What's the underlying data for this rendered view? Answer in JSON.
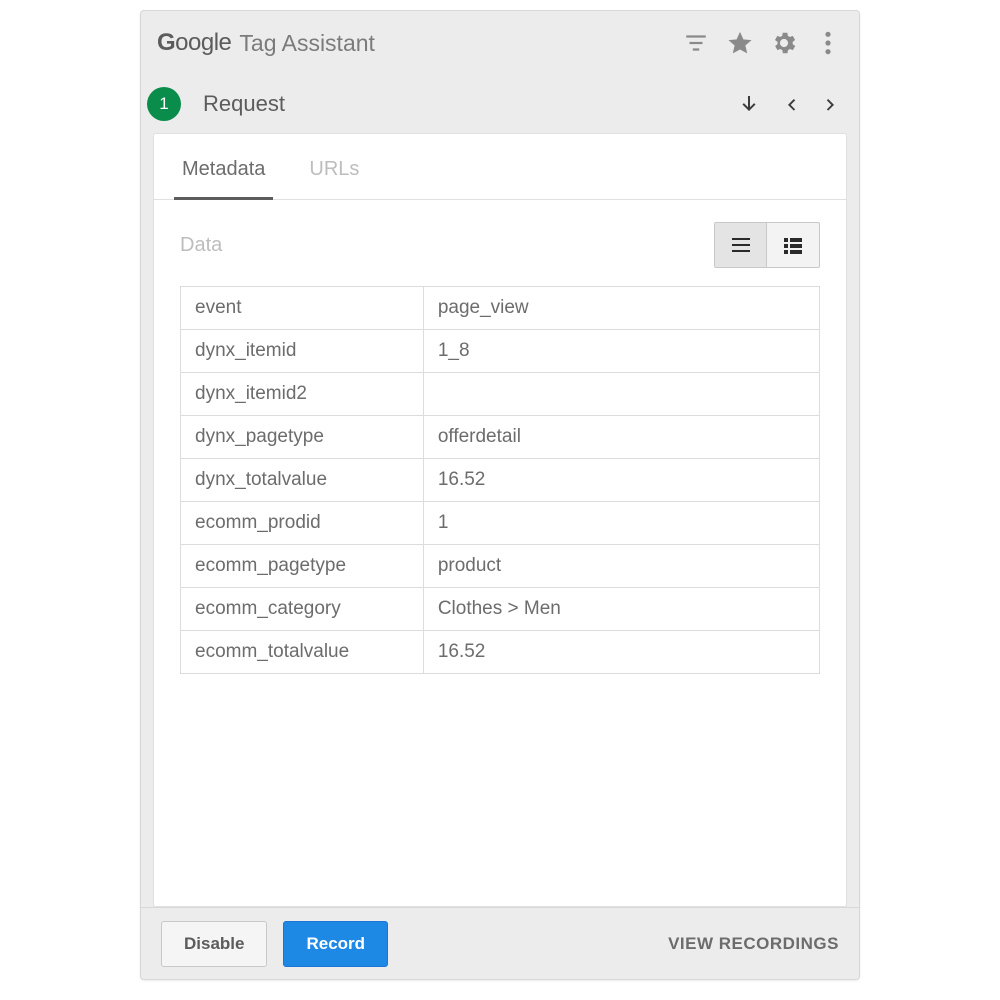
{
  "brand": {
    "google": "Google",
    "title": "Tag Assistant"
  },
  "badge": "1",
  "request_title": "Request",
  "tabs": {
    "metadata": "Metadata",
    "urls": "URLs"
  },
  "section": {
    "title": "Data"
  },
  "rows": [
    {
      "key": "event",
      "value": "page_view"
    },
    {
      "key": "dynx_itemid",
      "value": "1_8"
    },
    {
      "key": "dynx_itemid2",
      "value": ""
    },
    {
      "key": "dynx_pagetype",
      "value": "offerdetail"
    },
    {
      "key": "dynx_totalvalue",
      "value": "16.52"
    },
    {
      "key": "ecomm_prodid",
      "value": "1"
    },
    {
      "key": "ecomm_pagetype",
      "value": "product"
    },
    {
      "key": "ecomm_category",
      "value": "Clothes > Men"
    },
    {
      "key": "ecomm_totalvalue",
      "value": "16.52"
    }
  ],
  "footer": {
    "disable": "Disable",
    "record": "Record",
    "view_recordings": "VIEW RECORDINGS"
  }
}
